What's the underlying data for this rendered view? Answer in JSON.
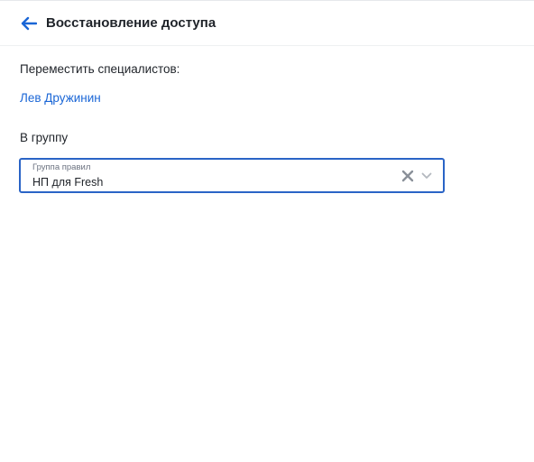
{
  "header": {
    "title": "Восстановление доступа",
    "back_icon": "arrow-left-icon"
  },
  "form": {
    "move_label": "Переместить специалистов:",
    "specialists": [
      "Лев Дружинин"
    ],
    "group_label": "В группу",
    "group_select": {
      "caption": "Группа правил",
      "value": "НП для Fresh",
      "clear_icon": "close-icon",
      "dropdown_icon": "chevron-down-icon"
    }
  },
  "colors": {
    "accent": "#2a64c6",
    "link": "#1a66d6",
    "text": "#1f2329",
    "muted": "#6b7280",
    "icon_gray": "#8a9099"
  }
}
